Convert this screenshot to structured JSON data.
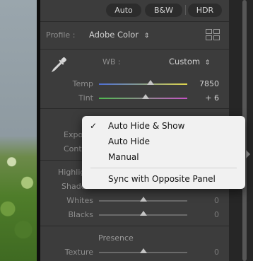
{
  "buttons": {
    "auto": "Auto",
    "bw": "B&W",
    "hdr": "HDR"
  },
  "profile": {
    "label": "Profile :",
    "value": "Adobe Color",
    "chevron": "⇕"
  },
  "wb": {
    "label": "WB :",
    "value": "Custom",
    "chevron": "⇕"
  },
  "sliders": {
    "temp": {
      "label": "Temp",
      "value": "7850"
    },
    "tint": {
      "label": "Tint",
      "value": "+ 6"
    },
    "exposure": {
      "label": "Expos"
    },
    "contrast": {
      "label": "Contr"
    },
    "highlights": {
      "label": "Highlig"
    },
    "shadows": {
      "label": "Shado"
    },
    "whites": {
      "label": "Whites",
      "value": "0"
    },
    "blacks": {
      "label": "Blacks",
      "value": "0"
    },
    "texture": {
      "label": "Texture",
      "value": "0"
    }
  },
  "presence": {
    "title": "Presence"
  },
  "context_menu": {
    "check": "✓",
    "items": [
      "Auto Hide & Show",
      "Auto Hide",
      "Manual"
    ],
    "sync": "Sync with Opposite Panel"
  },
  "icons": [
    "eyedropper-icon",
    "profile-grid-icon",
    "checkmark-icon",
    "panel-expand-icon"
  ]
}
